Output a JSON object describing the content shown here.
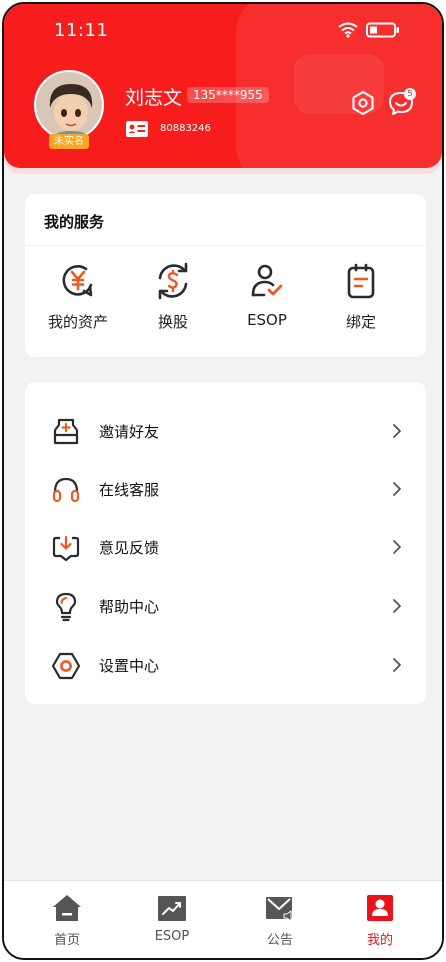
{
  "status_bar": {
    "time": "11:11"
  },
  "profile": {
    "name": "刘志文",
    "phone": "135****955",
    "verify_badge": "未实名",
    "user_id": "80883246",
    "message_count": "5"
  },
  "services": {
    "title": "我的服务",
    "items": [
      {
        "label": "我的资产",
        "icon": "asset-yuan-icon"
      },
      {
        "label": "换股",
        "icon": "exchange-dollar-icon"
      },
      {
        "label": "ESOP",
        "icon": "esop-user-icon"
      },
      {
        "label": "绑定",
        "icon": "bind-clipboard-icon"
      }
    ]
  },
  "menu": {
    "items": [
      {
        "label": "邀请好友",
        "icon": "invite-envelope-icon"
      },
      {
        "label": "在线客服",
        "icon": "headset-icon"
      },
      {
        "label": "意见反馈",
        "icon": "feedback-icon"
      },
      {
        "label": "帮助中心",
        "icon": "lightbulb-icon"
      },
      {
        "label": "设置中心",
        "icon": "settings-hexagon-icon"
      }
    ]
  },
  "tabbar": {
    "items": [
      {
        "label": "首页",
        "icon": "home-icon"
      },
      {
        "label": "ESOP",
        "icon": "chart-icon"
      },
      {
        "label": "公告",
        "icon": "announcement-icon"
      },
      {
        "label": "我的",
        "icon": "profile-icon"
      }
    ],
    "active": "我的"
  },
  "colors": {
    "brand_red": "#f71d1d",
    "accent_orange": "#f05a22",
    "badge_orange": "#f5a623",
    "active_tab": "#e8141c"
  }
}
